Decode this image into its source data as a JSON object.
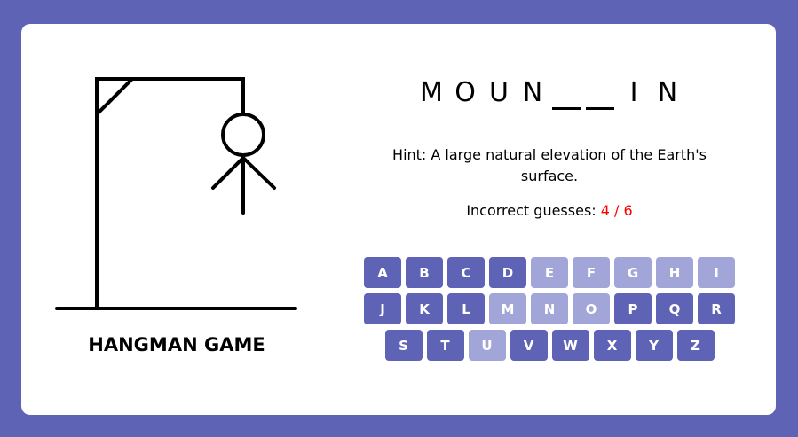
{
  "game": {
    "title": "HANGMAN GAME",
    "word_display": [
      "M",
      "O",
      "U",
      "N",
      "",
      "",
      "I",
      "N"
    ],
    "hint": "Hint: A large natural elevation of the Earth's surface.",
    "guess_label": "Incorrect guesses: ",
    "guess_count": "4 / 6"
  },
  "keyboard": [
    {
      "label": "A",
      "used": false
    },
    {
      "label": "B",
      "used": false
    },
    {
      "label": "C",
      "used": false
    },
    {
      "label": "D",
      "used": false
    },
    {
      "label": "E",
      "used": true
    },
    {
      "label": "F",
      "used": true
    },
    {
      "label": "G",
      "used": true
    },
    {
      "label": "H",
      "used": true
    },
    {
      "label": "I",
      "used": true
    },
    {
      "label": "J",
      "used": false
    },
    {
      "label": "K",
      "used": false
    },
    {
      "label": "L",
      "used": false
    },
    {
      "label": "M",
      "used": true
    },
    {
      "label": "N",
      "used": true
    },
    {
      "label": "O",
      "used": true
    },
    {
      "label": "P",
      "used": false
    },
    {
      "label": "Q",
      "used": false
    },
    {
      "label": "R",
      "used": false
    },
    {
      "label": "S",
      "used": false
    },
    {
      "label": "T",
      "used": false
    },
    {
      "label": "U",
      "used": true
    },
    {
      "label": "V",
      "used": false
    },
    {
      "label": "W",
      "used": false
    },
    {
      "label": "X",
      "used": false
    },
    {
      "label": "Y",
      "used": false
    },
    {
      "label": "Z",
      "used": false
    }
  ],
  "colors": {
    "background": "#5e63b6",
    "key_active": "#5e63b6",
    "key_used": "#a2a5d8",
    "guess_count": "#ff0000"
  }
}
